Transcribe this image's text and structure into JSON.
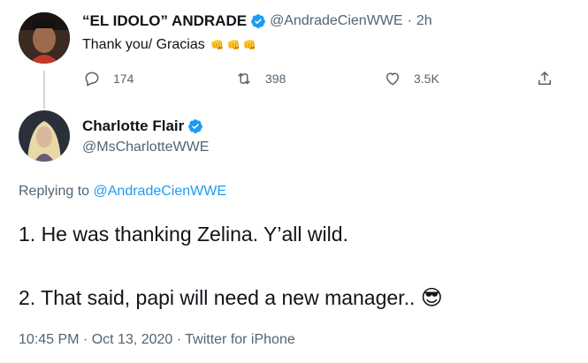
{
  "reply_to_tweet": {
    "author_name": "“EL IDOLO” ANDRADE",
    "author_handle": "@AndradeCienWWE",
    "separator": "·",
    "time": "2h",
    "text": "Thank you/ Gracias",
    "emojis": "👊 👊 👊",
    "actions": {
      "reply_count": "174",
      "retweet_count": "398",
      "like_count": "3.5K"
    }
  },
  "main_tweet": {
    "author_name": "Charlotte Flair",
    "author_handle": "@MsCharlotteWWE",
    "replying_prefix": "Replying to",
    "replying_handle": "@AndradeCienWWE",
    "line1": "1. He was thanking Zelina. Y’all wild.",
    "line2": "2. That said, papi will need a new manager..",
    "emoji": "😎",
    "meta": "10:45 PM · Oct 13, 2020 · Twitter for iPhone"
  },
  "colors": {
    "verified": "#1d9bf0",
    "link": "#1d9bf0",
    "secondary": "#536471"
  },
  "icons": [
    "reply-icon",
    "retweet-icon",
    "like-icon",
    "share-icon",
    "verified-badge-icon"
  ]
}
